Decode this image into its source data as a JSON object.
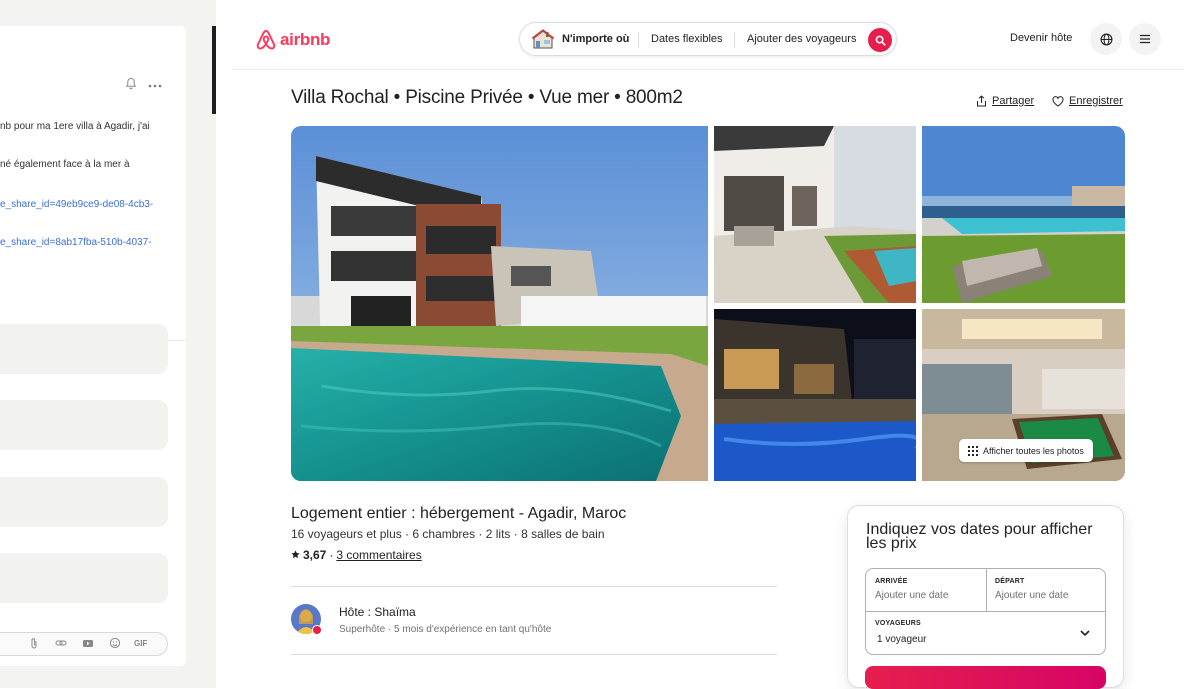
{
  "chat": {
    "lines": [
      "nb pour ma 1ere villa à Agadir, j'ai",
      "né également face à la mer à",
      "e_share_id=49eb9ce9-de08-4cb3-",
      "e_share_id=8ab17fba-510b-4037-"
    ],
    "composer_gif": "GIF"
  },
  "header": {
    "logo_text": "airbnb",
    "search": {
      "anywhere": "N'importe où",
      "dates": "Dates flexibles",
      "guests": "Ajouter des voyageurs"
    },
    "become_host": "Devenir hôte"
  },
  "listing": {
    "title": "Villa Rochal • Piscine Privée • Vue mer • 800m2",
    "share_label": "Partager",
    "save_label": "Enregistrer",
    "show_all_photos": "Afficher toutes les photos",
    "lodging_title": "Logement entier : hébergement - Agadir, Maroc",
    "details": "16 voyageurs et plus · 6 chambres · 2 lits · 8 salles de bain",
    "rating": "3,67",
    "rating_separator": "·",
    "reviews": "3 commentaires",
    "host_name": "Hôte : Shaïma",
    "host_info": "Superhôte · 5 mois d'expérience en tant qu'hôte"
  },
  "booking": {
    "heading": "Indiquez vos dates pour afficher les prix",
    "checkin_label": "ARRIVÉE",
    "checkin_placeholder": "Ajouter une date",
    "checkout_label": "DÉPART",
    "checkout_placeholder": "Ajouter une date",
    "guests_label": "VOYAGEURS",
    "guests_value": "1 voyageur"
  },
  "colors": {
    "brand": "#ff385c",
    "search_button": "#e61e4d",
    "link": "#3b6fd6"
  }
}
